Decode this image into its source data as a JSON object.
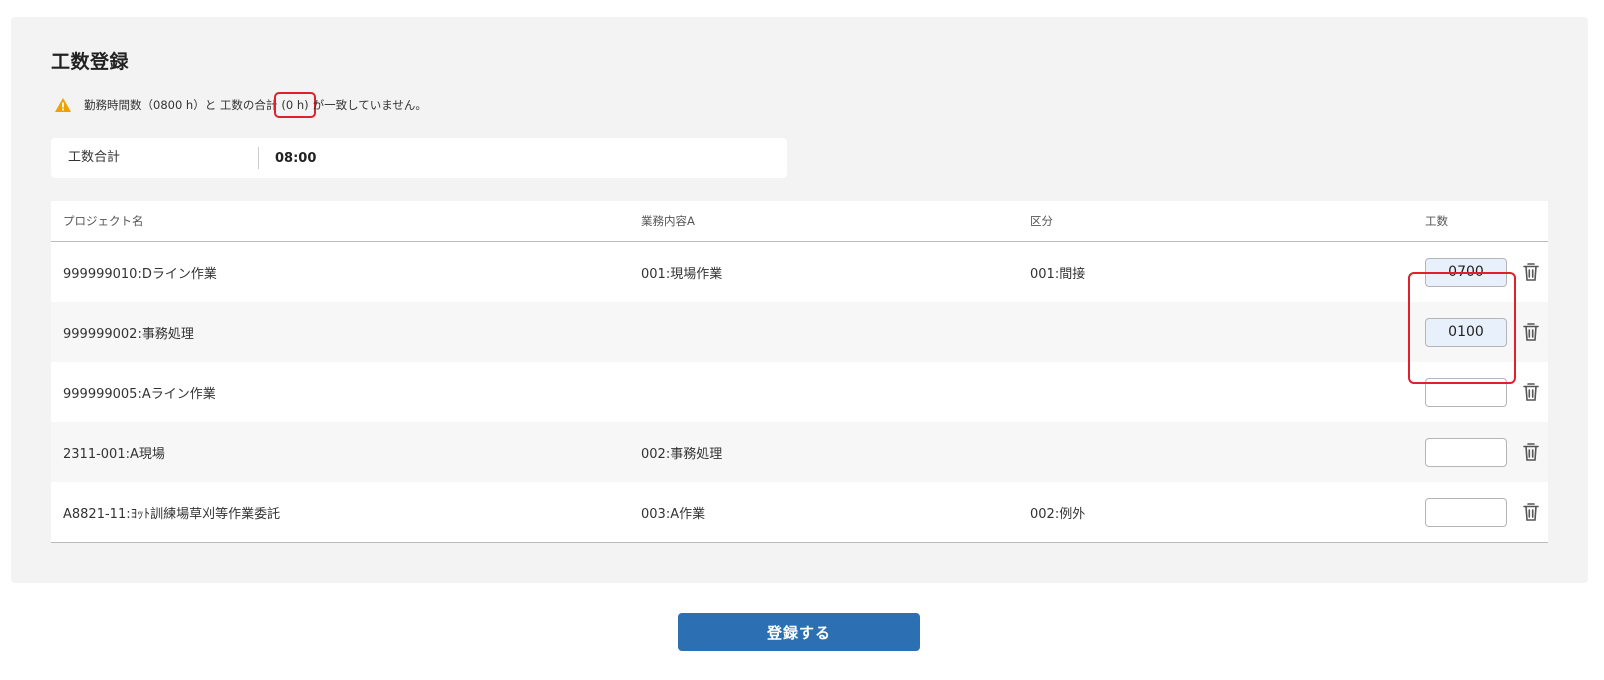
{
  "page": {
    "title": "工数登録"
  },
  "warning": {
    "icon": "warning-icon",
    "text_before": "勤務時間数（0800 h）と 工数の合計",
    "text_highlight": "(0 h)",
    "text_after": "が一致していません。"
  },
  "total": {
    "label": "工数合計",
    "value": "08:00"
  },
  "table": {
    "headers": {
      "project": "プロジェクト名",
      "task": "業務内容A",
      "category": "区分",
      "hours": "工数"
    },
    "rows": [
      {
        "project": "999999010:Dライン作業",
        "task": "001:現場作業",
        "category": "001:間接",
        "hours": "0700"
      },
      {
        "project": "999999002:事務処理",
        "task": "",
        "category": "",
        "hours": "0100"
      },
      {
        "project": "999999005:Aライン作業",
        "task": "",
        "category": "",
        "hours": ""
      },
      {
        "project": "2311-001:A現場",
        "task": "002:事務処理",
        "category": "",
        "hours": ""
      },
      {
        "project": "A8821-11:ﾖｯﾄ訓練場草刈等作業委託",
        "task": "003:A作業",
        "category": "002:例外",
        "hours": ""
      }
    ]
  },
  "actions": {
    "submit_label": "登録する"
  },
  "colors": {
    "accent": "#2d6fb3",
    "highlight": "#e0202a",
    "warning": "#f0a000",
    "panel": "#f3f3f3"
  }
}
